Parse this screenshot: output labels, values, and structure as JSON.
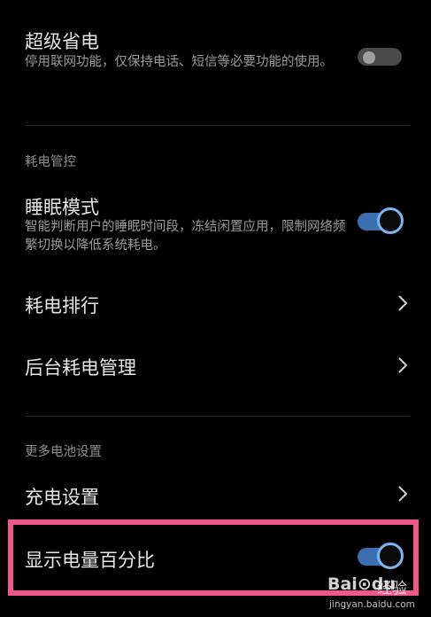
{
  "super_saver": {
    "title": "超级省电",
    "desc": "停用联网功能，仅保持电话、短信等必要功能的使用。",
    "toggle_on": false
  },
  "section_power_control": "耗电管控",
  "sleep_mode": {
    "title": "睡眠模式",
    "desc": "智能判断用户的睡眠时间段，冻结闲置应用，限制网络频繁切换以降低系统耗电。",
    "toggle_on": true
  },
  "power_ranking": {
    "title": "耗电排行"
  },
  "background_power": {
    "title": "后台耗电管理"
  },
  "section_more_battery": "更多电池设置",
  "charge_settings": {
    "title": "充电设置"
  },
  "battery_percentage": {
    "title": "显示电量百分比",
    "toggle_on": true
  },
  "watermark": {
    "logo": "Bai⊙du",
    "logo_cn": "经验",
    "url": "jingyan.baidu.com"
  },
  "colors": {
    "background": "#000000",
    "toggle_on_track": "#3b6fb0",
    "toggle_on_knob_ring": "#7cb3f0",
    "toggle_off_track": "#4a4a4a",
    "highlight_border": "#f0588a"
  }
}
